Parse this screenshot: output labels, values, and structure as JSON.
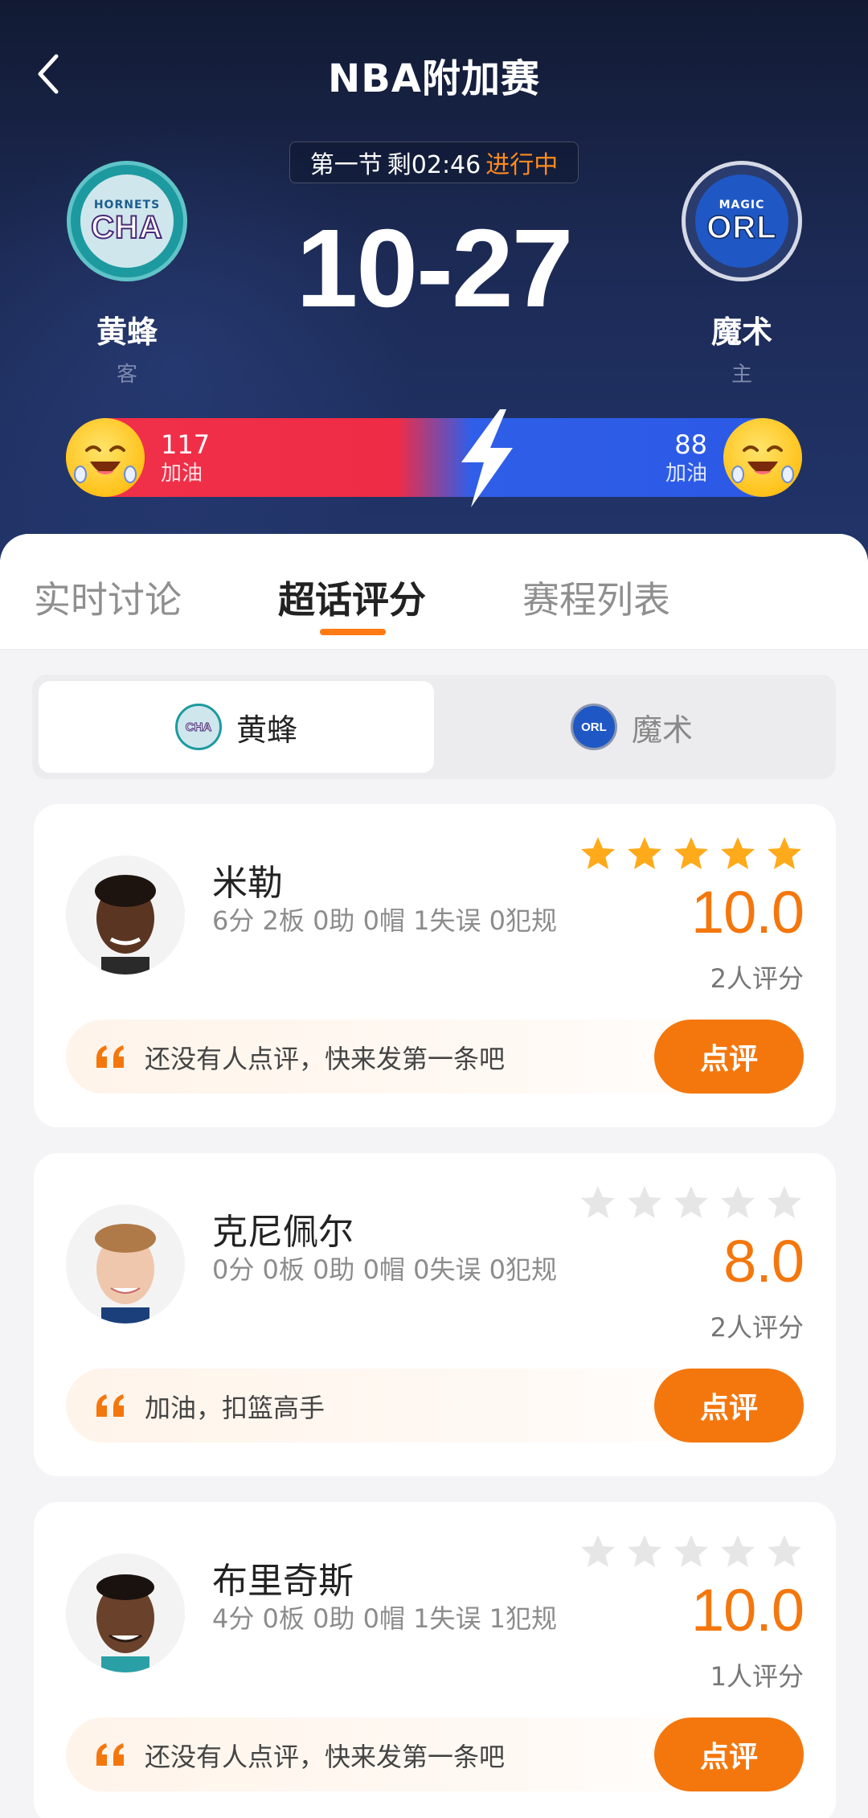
{
  "header": {
    "title": "NBA附加赛",
    "period": "第一节",
    "remaining": "剩02:46",
    "status": "进行中",
    "score": "10-27"
  },
  "teams": {
    "away": {
      "name": "黄蜂",
      "role": "客",
      "logo_small": "HORNETS",
      "logo_abbr": "CHA"
    },
    "home": {
      "name": "魔术",
      "role": "主",
      "logo_small": "MAGIC",
      "logo_abbr": "ORL"
    }
  },
  "cheer": {
    "away_count": "117",
    "away_label": "加油",
    "home_count": "88",
    "home_label": "加油"
  },
  "tabs": [
    "实时讨论",
    "超话评分",
    "赛程列表"
  ],
  "active_tab": 1,
  "team_switch": {
    "selected": "黄蜂",
    "other": "魔术"
  },
  "players": [
    {
      "name": "米勒",
      "stats": "6分 2板 0助 0帽 1失误 0犯规",
      "stars_filled": 5,
      "rating": "10.0",
      "rating_count": "2人评分",
      "comment": "还没有人点评，快来发第一条吧",
      "button": "点评"
    },
    {
      "name": "克尼佩尔",
      "stats": "0分 0板 0助 0帽 0失误 0犯规",
      "stars_filled": 0,
      "rating": "8.0",
      "rating_count": "2人评分",
      "comment": "加油，扣篮高手",
      "button": "点评"
    },
    {
      "name": "布里奇斯",
      "stats": "4分 0板 0助 0帽 1失误 1犯规",
      "stars_filled": 0,
      "rating": "10.0",
      "rating_count": "1人评分",
      "comment": "还没有人点评，快来发第一条吧",
      "button": "点评"
    }
  ],
  "colors": {
    "accent": "#f4770d",
    "away_bar": "#f0304a",
    "home_bar": "#2b59e6",
    "star_filled": "#ffaa1a",
    "star_empty": "#e6e6e6"
  }
}
